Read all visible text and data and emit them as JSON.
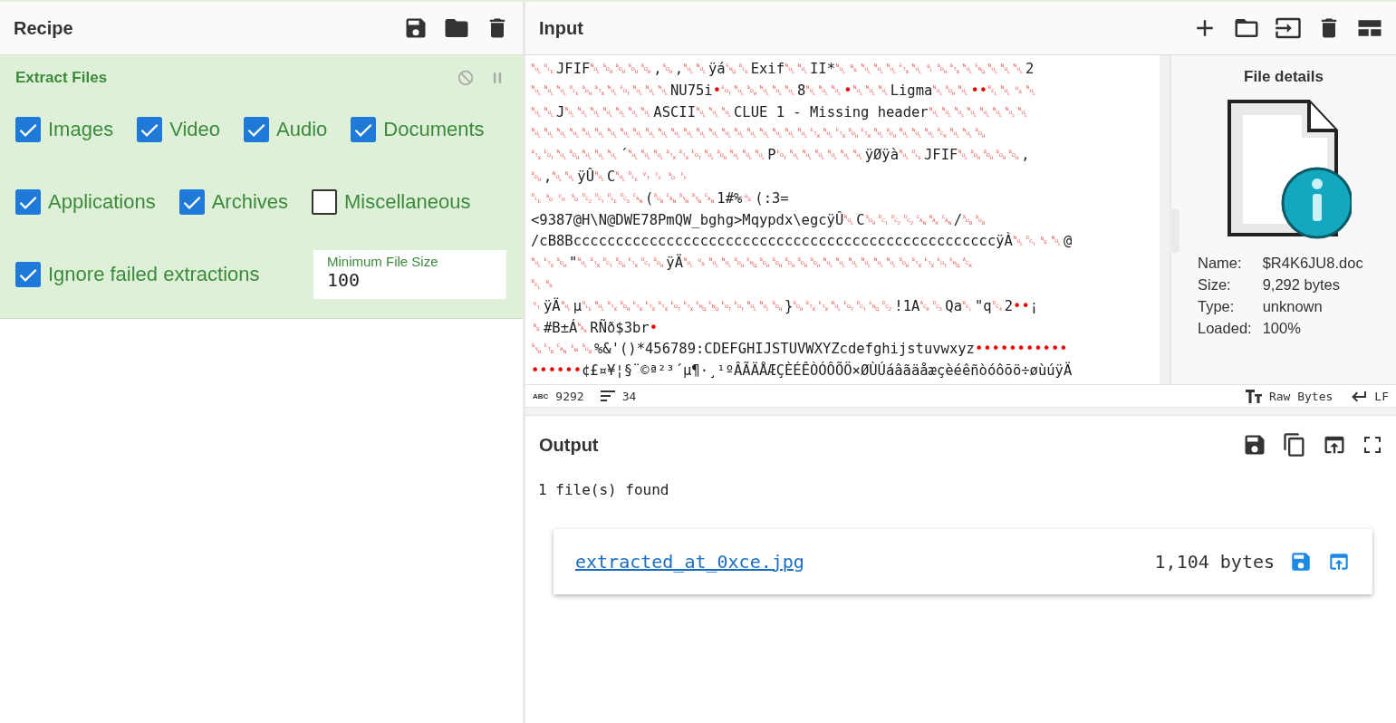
{
  "recipe": {
    "title": "Recipe",
    "operations": [
      {
        "name": "Extract Files",
        "option_rows": [
          [
            {
              "kind": "checkbox",
              "label": "Images",
              "checked": true
            },
            {
              "kind": "checkbox",
              "label": "Video",
              "checked": true
            },
            {
              "kind": "checkbox",
              "label": "Audio",
              "checked": true
            },
            {
              "kind": "checkbox",
              "label": "Documents",
              "checked": true
            }
          ],
          [
            {
              "kind": "checkbox",
              "label": "Applications",
              "checked": true
            },
            {
              "kind": "checkbox",
              "label": "Archives",
              "checked": true
            },
            {
              "kind": "checkbox",
              "label": "Miscellaneous",
              "checked": false
            }
          ],
          [
            {
              "kind": "checkbox",
              "label": "Ignore failed extractions",
              "checked": true
            },
            {
              "kind": "number",
              "label": "Minimum File Size",
              "value": "100"
            }
          ]
        ]
      }
    ]
  },
  "input": {
    "title": "Input",
    "lines": [
      "␀␐JFIF␀␁␁␁␁,␁,␀␀ÿá␅␐Exif␀␀II*␀␈␀␀␀␃␀␏␁␂␀␅␀␀␀2",
      "␀␀␀␐␁␂␀␄␀␀␀NU75i•␄␀␁␀␀␀8␀␀␀•␀␀␀Ligma␀␁␀••␇␀␟␀",
      "␀␀J␀␀␀␀␀␀␀ASCII␀␀␀CLUE 1 - Missing header␀␀␀␀␀␀␀␀",
      "␀␀␀␀␀␀␀␀␀␀␀␀␀␀␀␀␀␀␀␀␀␀␃␀␃␁␃␀␁␀␀␀␆␀␀␁",
      "␂␄␀␁␀␀␀´␀␀␀␂␂␄␀␁␀␀␀P␄␀␀␀␀␀␀ÿØÿà␀␐JFIF␀␁␁␁␁,",
      "␁,␀␀ÿÛ␀C␀␐␋␌␎␌",
      "␐␎␍␎␒␑␐␓␘(␚␘␖␖␘1#%␝(:3=",
      "<9387@H\\N@DWE78PmQW_bghg>Mqypdx\\egcÿÛ␀C␁␑␒␒␘␕␘/␚␚",
      "/cB8BccccccccccccccccccccccccccccccccccccccccccccccccccÿÀ␀␑␈␀@",
      "␀␃␁\"␀␂␑␁␃␑␁ÿÄ␀␟␀␀␁␅␁␁␁␁␁␀␀␀␀␀␀␁␂␃␄␅␆",
      "␇␈",
      "␋ÿÄ␀µ␐␀␂␁␃␃␂␄␃␅␅␄␄␀␀␁}␁␂␃␀␄␑␅␒!1A␆␓Qa␇\"q␔2••¡",
      "␈#B±Á␕RÑð$3br•",
      "␖␗␘␙␚%&'()*456789:CDEFGHIJSTUVWXYZcdefghijstuvwxyz•••••••••••",
      "••••••¢£¤¥¦§¨©ª²³´µ¶·¸¹ºÂÃÄÅÆÇÈÉÊÒÓÔÕÖ×ØÙÚáâãäåæçèéêñòóôõö÷øùúÿÄ"
    ],
    "file_details": {
      "title": "File details",
      "rows": [
        {
          "label": "Name:",
          "value": "$R4K6JU8.doc"
        },
        {
          "label": "Size:",
          "value": "9,292 bytes"
        },
        {
          "label": "Type:",
          "value": "unknown"
        },
        {
          "label": "Loaded:",
          "value": "100%"
        }
      ]
    },
    "status": {
      "chars_label": "ABC",
      "chars": "9292",
      "lines": "34",
      "encoding": "Raw Bytes",
      "eol": "LF"
    }
  },
  "output": {
    "title": "Output",
    "message": "1 file(s) found",
    "files": [
      {
        "name": "extracted_at_0xce.jpg",
        "size": "1,104 bytes"
      }
    ]
  }
}
